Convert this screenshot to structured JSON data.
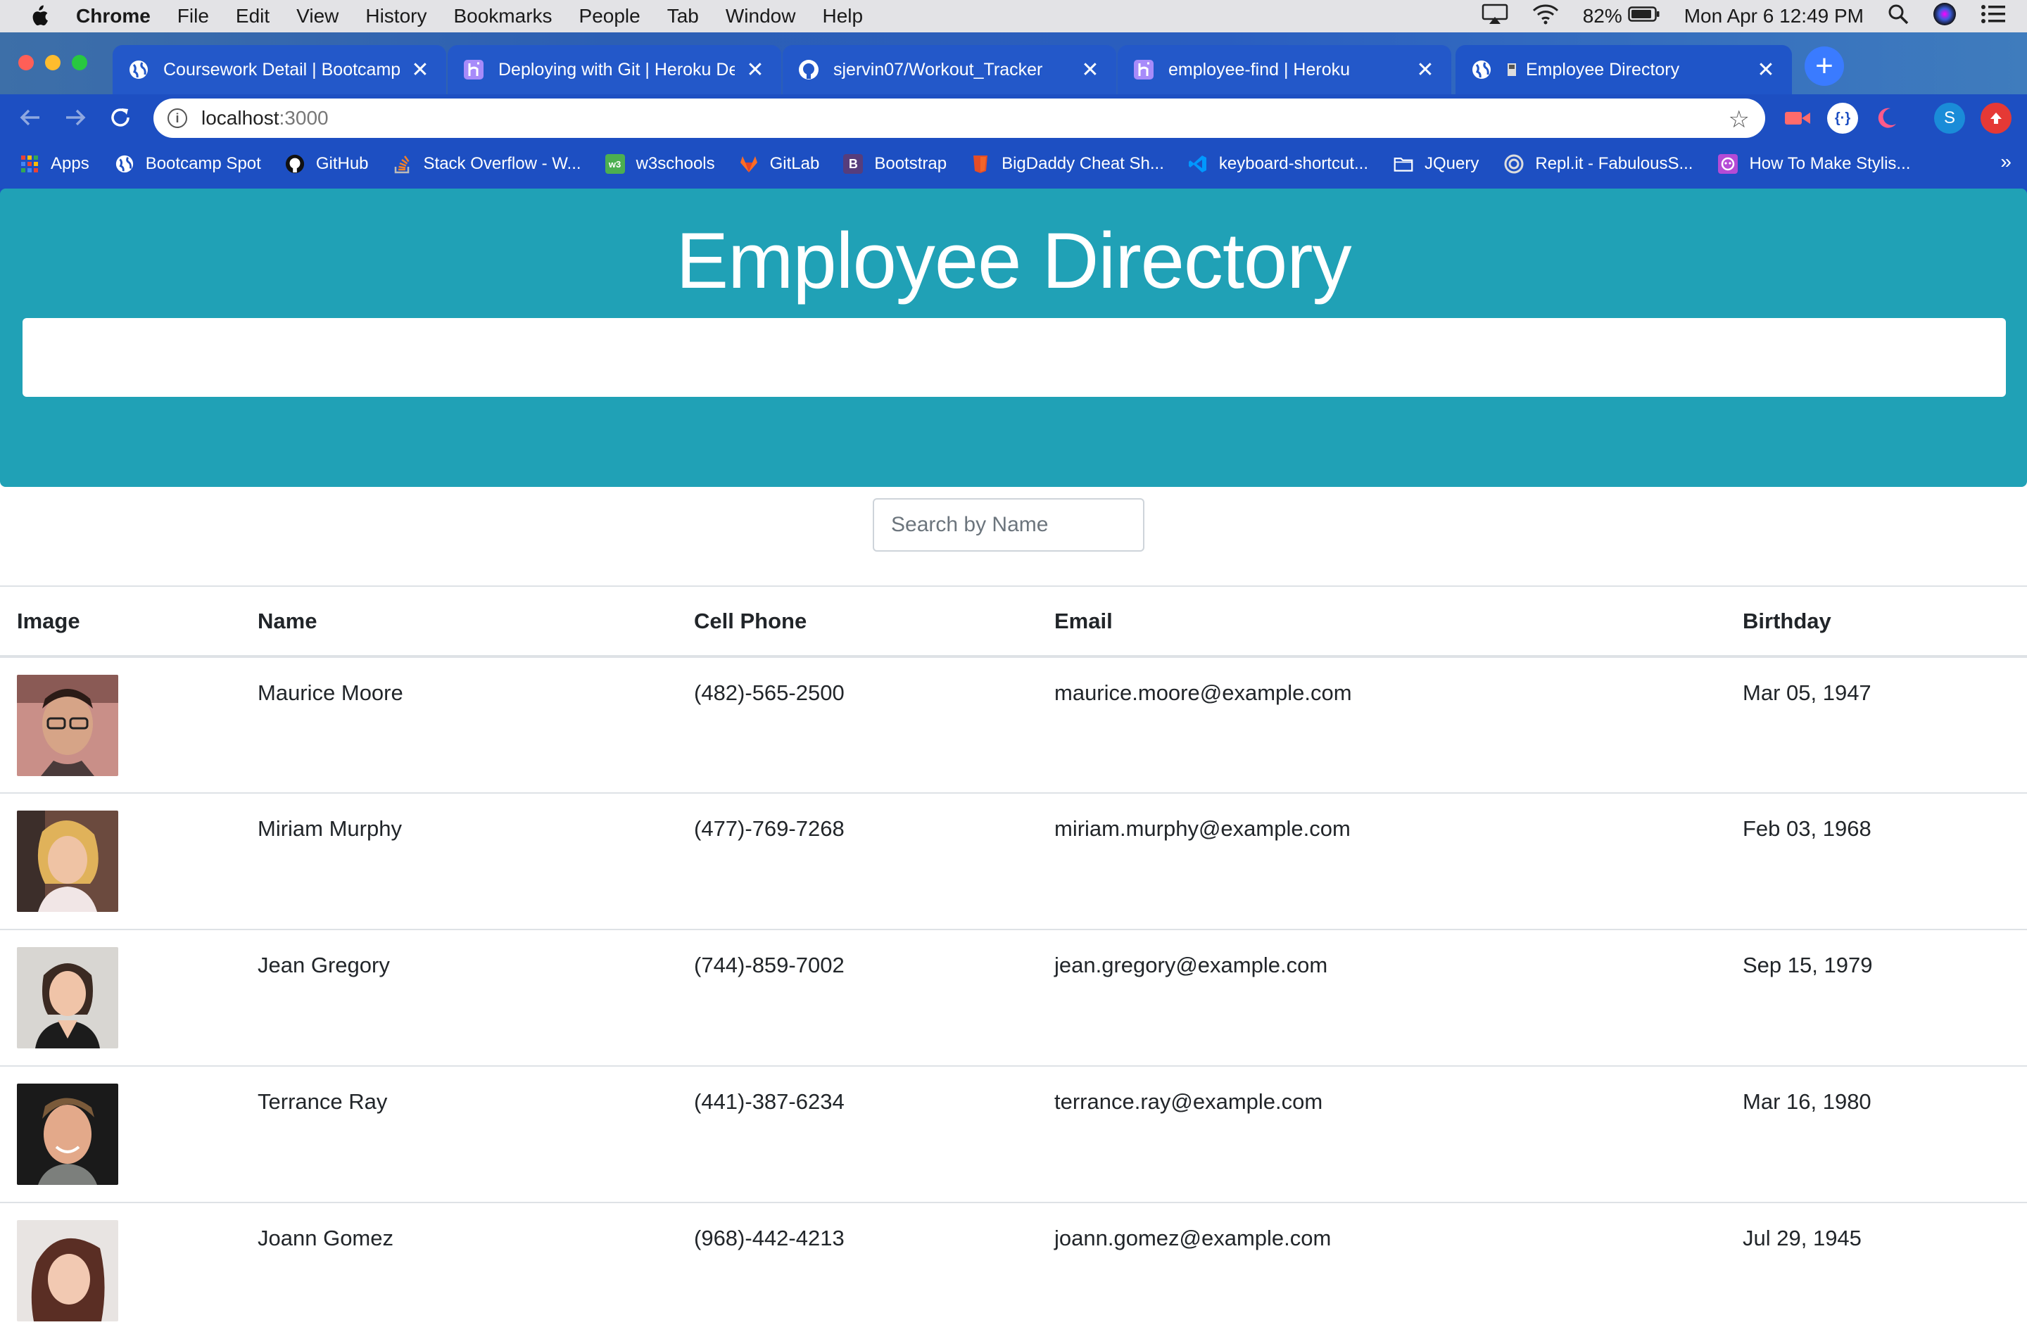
{
  "menubar": {
    "app": "Chrome",
    "items": [
      "File",
      "Edit",
      "View",
      "History",
      "Bookmarks",
      "People",
      "Tab",
      "Window",
      "Help"
    ],
    "battery": "82%",
    "datetime": "Mon Apr 6  12:49 PM"
  },
  "tabs": [
    {
      "title": "Coursework Detail | Bootcamp S",
      "icon": "globe-icon"
    },
    {
      "title": "Deploying with Git | Heroku Dev",
      "icon": "heroku-icon"
    },
    {
      "title": "sjervin07/Workout_Tracker",
      "icon": "github-icon"
    },
    {
      "title": "employee-find | Heroku",
      "icon": "heroku-icon"
    },
    {
      "title": "Employee Directory",
      "icon": "globe-icon",
      "active": true
    }
  ],
  "address": {
    "host": "localhost",
    "port": ":3000"
  },
  "profile": {
    "initial": "S"
  },
  "bookmarks": [
    {
      "label": "Apps",
      "icon": "apps-grid-icon",
      "color": "#e8453c"
    },
    {
      "label": "Bootcamp Spot",
      "icon": "globe-icon",
      "color": "#ffffff"
    },
    {
      "label": "GitHub",
      "icon": "github-icon",
      "color": "#111111"
    },
    {
      "label": "Stack Overflow - W...",
      "icon": "stackoverflow-icon",
      "color": "#f48024"
    },
    {
      "label": "w3schools",
      "icon": "w3schools-icon",
      "color": "#4caf50"
    },
    {
      "label": "GitLab",
      "icon": "gitlab-icon",
      "color": "#fc6d26"
    },
    {
      "label": "Bootstrap",
      "icon": "bootstrap-icon",
      "color": "#563d7c"
    },
    {
      "label": "BigDaddy Cheat Sh...",
      "icon": "bigdaddy-icon",
      "color": "#e44d26"
    },
    {
      "label": "keyboard-shortcut...",
      "icon": "vscode-icon",
      "color": "#007acc"
    },
    {
      "label": "JQuery",
      "icon": "folder-icon",
      "color": "#ffffff"
    },
    {
      "label": "Repl.it - FabulousS...",
      "icon": "replit-icon",
      "color": "#ffffff"
    },
    {
      "label": "How To Make Stylis...",
      "icon": "howto-icon",
      "color": "#b44bd6"
    }
  ],
  "bookmarks_more": "»",
  "page": {
    "title": "Employee Directory",
    "search_placeholder": "Search by Name",
    "hero_color": "#20a1b6"
  },
  "table": {
    "headers": [
      "Image",
      "Name",
      "Cell Phone",
      "Email",
      "Birthday"
    ],
    "rows": [
      {
        "name": "Maurice Moore",
        "phone": "(482)-565-2500",
        "email": "maurice.moore@example.com",
        "birthday": "Mar 05, 1947"
      },
      {
        "name": "Miriam Murphy",
        "phone": "(477)-769-7268",
        "email": "miriam.murphy@example.com",
        "birthday": "Feb 03, 1968"
      },
      {
        "name": "Jean Gregory",
        "phone": "(744)-859-7002",
        "email": "jean.gregory@example.com",
        "birthday": "Sep 15, 1979"
      },
      {
        "name": "Terrance Ray",
        "phone": "(441)-387-6234",
        "email": "terrance.ray@example.com",
        "birthday": "Mar 16, 1980"
      },
      {
        "name": "Joann Gomez",
        "phone": "(968)-442-4213",
        "email": "joann.gomez@example.com",
        "birthday": "Jul 29, 1945"
      }
    ]
  }
}
